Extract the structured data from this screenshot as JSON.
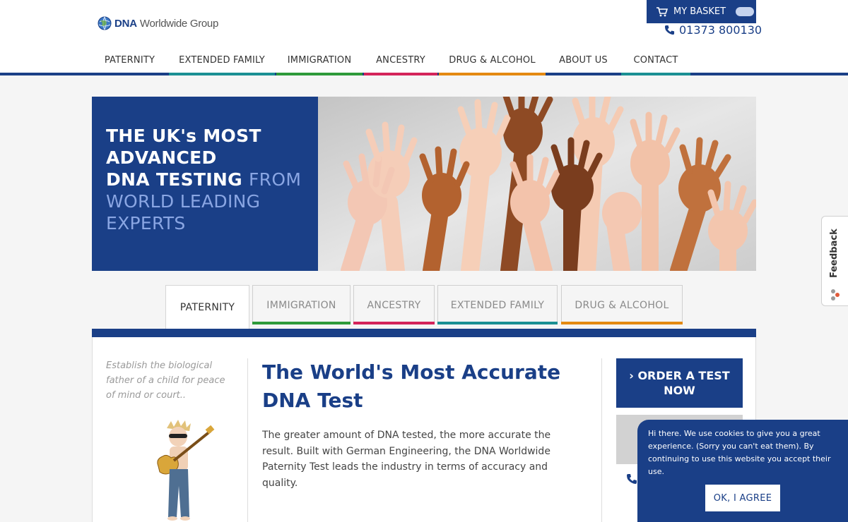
{
  "header": {
    "logo_brand": "DNA",
    "logo_rest": "Worldwide Group",
    "basket_label": "MY BASKET",
    "phone": "01373 800130"
  },
  "nav": {
    "items": [
      {
        "label": "PATERNITY",
        "color": "#1a3f87"
      },
      {
        "label": "EXTENDED FAMILY",
        "color": "#1a8f93"
      },
      {
        "label": "IMMIGRATION",
        "color": "#2e9a3a"
      },
      {
        "label": "ANCESTRY",
        "color": "#d4245a"
      },
      {
        "label": "DRUG & ALCOHOL",
        "color": "#e48a12"
      },
      {
        "label": "ABOUT US",
        "color": "#1a3f87"
      },
      {
        "label": "CONTACT",
        "color": "#1a8f93"
      }
    ]
  },
  "hero": {
    "line1": "THE UK's MOST",
    "line2": "ADVANCED",
    "line3a": "DNA TESTING",
    "line3b": "FROM",
    "line4": "WORLD LEADING",
    "line5": "EXPERTS"
  },
  "tabs": {
    "items": [
      {
        "label": "PATERNITY",
        "color": "#1a3f87"
      },
      {
        "label": "IMMIGRATION",
        "color": "#2e9a3a"
      },
      {
        "label": "ANCESTRY",
        "color": "#d4245a"
      },
      {
        "label": "EXTENDED FAMILY",
        "color": "#1a8f93"
      },
      {
        "label": "DRUG & ALCOHOL",
        "color": "#e48a12"
      }
    ]
  },
  "content": {
    "tagline": "Establish the biological father of a child for peace of mind or court..",
    "title": "The World's Most Accurate DNA Test",
    "body": "The greater amount of DNA tested, the more accurate the result. Built with German Engineering, the DNA Worldwide Paternity Test leads the industry in terms of accuracy and quality.",
    "order_label": "ORDER A TEST NOW"
  },
  "feedback": {
    "label": "Feedback"
  },
  "cookie": {
    "text": "Hi there. We use cookies to give you a great experience. (Sorry you can't eat them). By continuing to use this website you accept their use.",
    "button": "OK, I AGREE"
  },
  "colors": {
    "brand_blue": "#1a3f87",
    "hero_accent": "#8aa6e3"
  }
}
